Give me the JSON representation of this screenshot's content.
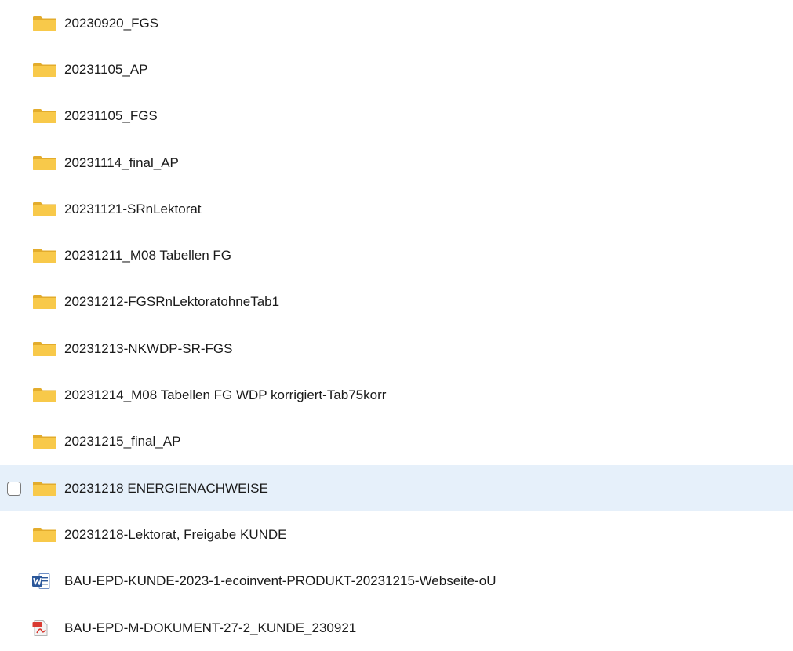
{
  "files": [
    {
      "name": "20230920_FGS",
      "icon": "folder-icon",
      "selected": false
    },
    {
      "name": "20231105_AP",
      "icon": "folder-icon",
      "selected": false
    },
    {
      "name": "20231105_FGS",
      "icon": "folder-icon",
      "selected": false
    },
    {
      "name": "20231114_final_AP",
      "icon": "folder-icon",
      "selected": false
    },
    {
      "name": "20231121-SRnLektorat",
      "icon": "folder-icon",
      "selected": false
    },
    {
      "name": "20231211_M08 Tabellen FG",
      "icon": "folder-icon",
      "selected": false
    },
    {
      "name": "20231212-FGSRnLektoratohneTab1",
      "icon": "folder-icon",
      "selected": false
    },
    {
      "name": "20231213-NKWDP-SR-FGS",
      "icon": "folder-icon",
      "selected": false
    },
    {
      "name": "20231214_M08 Tabellen FG WDP korrigiert-Tab75korr",
      "icon": "folder-icon",
      "selected": false
    },
    {
      "name": "20231215_final_AP",
      "icon": "folder-icon",
      "selected": false
    },
    {
      "name": "20231218 ENERGIENACHWEISE",
      "icon": "folder-icon",
      "selected": true
    },
    {
      "name": "20231218-Lektorat, Freigabe KUNDE",
      "icon": "folder-icon",
      "selected": false
    },
    {
      "name": "BAU-EPD-KUNDE-2023-1-ecoinvent-PRODUKT-20231215-Webseite-oU",
      "icon": "word-document-icon",
      "selected": false
    },
    {
      "name": "BAU-EPD-M-DOKUMENT-27-2_KUNDE_230921",
      "icon": "pdf-document-icon",
      "selected": false
    }
  ],
  "colors": {
    "selection_background": "#e6f0fa",
    "folder_yellow": "#f8c94a",
    "word_blue": "#2b579a",
    "pdf_red": "#d93a31"
  }
}
